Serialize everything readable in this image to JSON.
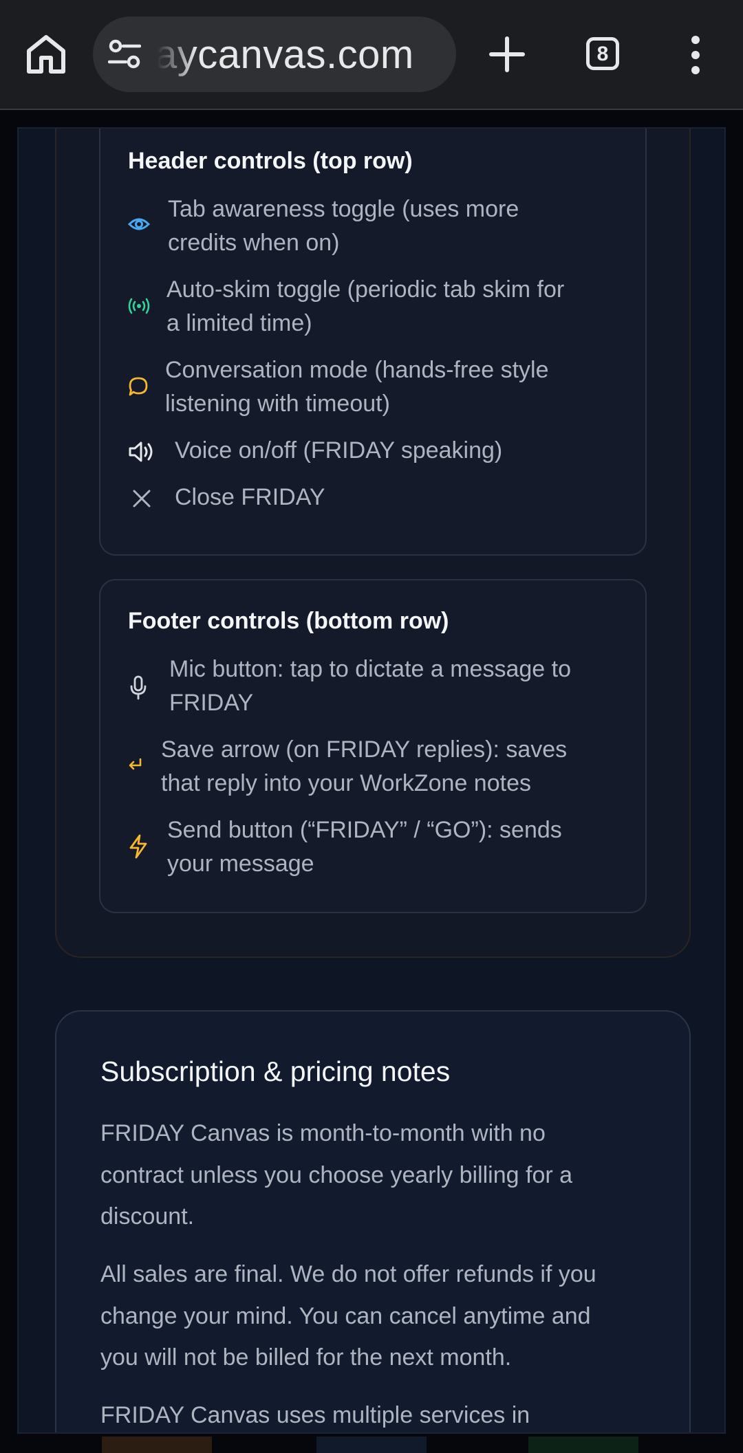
{
  "browser": {
    "url": "fridaycanvas.com",
    "url_visible": "aycanvas.com",
    "tab_count": "8",
    "icons": [
      "home-icon",
      "tune-icon",
      "plus-icon",
      "tabs-icon",
      "more-vert-icon"
    ]
  },
  "header_controls": {
    "title": "Header controls (top row)",
    "items": [
      {
        "icon": "eye-icon",
        "color": "#4aa8f0",
        "line1": "Tab awareness toggle (uses more",
        "line2": "credits when on)"
      },
      {
        "icon": "broadcast-icon",
        "color": "#34d399",
        "line1": "Auto-skim toggle (periodic tab skim for",
        "line2": "a limited time)"
      },
      {
        "icon": "chat-bubble-icon",
        "color": "#f5b82e",
        "line1": "Conversation mode (hands-free style",
        "line2": "listening with timeout)"
      },
      {
        "icon": "speaker-icon",
        "color": "#e5e7eb",
        "line1": "Voice on/off (FRIDAY speaking)"
      },
      {
        "icon": "close-icon",
        "color": "#aeb4c0",
        "line1": "Close FRIDAY"
      }
    ]
  },
  "footer_controls": {
    "title": "Footer controls (bottom row)",
    "items": [
      {
        "icon": "mic-icon",
        "color": "#d1d5db",
        "line1": "Mic button: tap to dictate a message to",
        "line2": "FRIDAY"
      },
      {
        "icon": "return-arrow-icon",
        "color": "#f5b82e",
        "line1": "Save arrow (on FRIDAY replies): saves",
        "line2": "that reply into your WorkZone notes"
      },
      {
        "icon": "lightning-icon",
        "color": "#f5b82e",
        "line1": "Send button (“FRIDAY” / “GO”): sends",
        "line2": "your message"
      }
    ]
  },
  "subscription": {
    "title": "Subscription & pricing notes",
    "paragraphs": [
      {
        "lines": [
          "FRIDAY Canvas is month-to-month with no",
          "contract unless you choose yearly billing for a",
          "discount."
        ]
      },
      {
        "lines": [
          "All sales are final. We do not offer refunds if you",
          "change your mind. You can cancel anytime and",
          "you will not be billed for the next month."
        ]
      },
      {
        "lines": [
          "FRIDAY Canvas uses multiple services in"
        ]
      }
    ]
  }
}
